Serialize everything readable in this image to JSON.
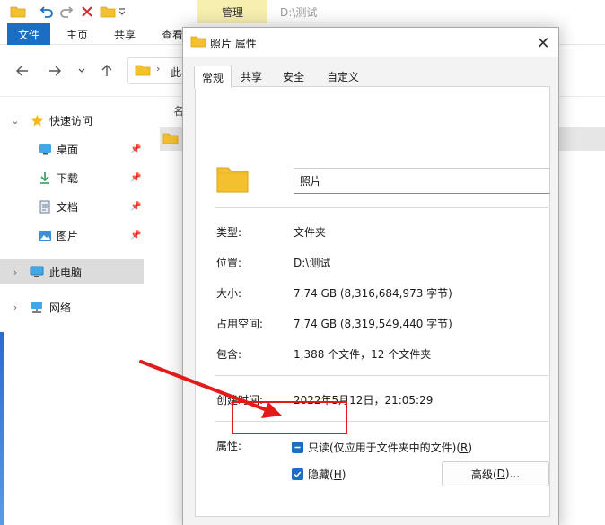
{
  "explorer": {
    "manage_tab": "管理",
    "title_path": "D:\\测试",
    "ribbon_tabs": [
      "文件",
      "主页",
      "共享",
      "查看"
    ],
    "address_text": "此",
    "column_header": "名",
    "sidebar": {
      "quick_access": "快速访问",
      "desktop": "桌面",
      "downloads": "下载",
      "documents": "文档",
      "pictures": "图片",
      "this_pc": "此电脑",
      "network": "网络"
    }
  },
  "dialog": {
    "title": "照片 属性",
    "tabs": [
      "常规",
      "共享",
      "安全",
      "自定义"
    ],
    "active_tab": "常规",
    "name_value": "照片",
    "props": {
      "type_label": "类型:",
      "type_value": "文件夹",
      "location_label": "位置:",
      "location_value": "D:\\测试",
      "size_label": "大小:",
      "size_value": "7.74 GB (8,316,684,973 字节)",
      "size_on_disk_label": "占用空间:",
      "size_on_disk_value": "7.74 GB (8,319,549,440 字节)",
      "contains_label": "包含:",
      "contains_value": "1,388 个文件，12 个文件夹",
      "created_label": "创建时间:",
      "created_value": "2022年5月12日，21:05:29",
      "attributes_label": "属性:"
    },
    "readonly": {
      "text": "只读(仅应用于文件夹中的文件)(",
      "key": "R",
      "end": ")",
      "state": "indeterminate"
    },
    "hidden": {
      "text": "隐藏(",
      "key": "H",
      "end": ")",
      "checked": true
    },
    "advanced": {
      "text": "高级(",
      "key": "D",
      "end": ")..."
    }
  },
  "colors": {
    "accent": "#1a6fc4",
    "annotation": "#e21a1a",
    "manage_tab_bg": "#f6efb0",
    "folder": "#f3c02f"
  }
}
